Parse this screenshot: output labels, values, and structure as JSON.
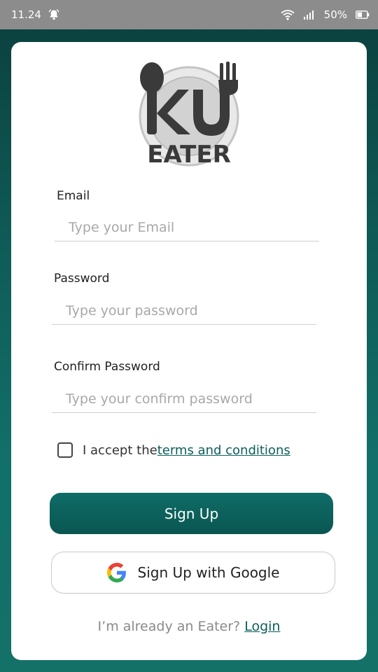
{
  "status_bar": {
    "time": "11.24",
    "battery": "50%",
    "icons": [
      "notification-bell-icon",
      "wifi-icon",
      "signal-icon",
      "battery-icon"
    ]
  },
  "logo": {
    "top_text": "KU",
    "bottom_text": "EATER"
  },
  "form": {
    "email": {
      "label": "Email",
      "placeholder": "Type your Email",
      "value": ""
    },
    "password": {
      "label": "Password",
      "placeholder": "Type your password",
      "value": ""
    },
    "confirm": {
      "label": "Confirm Password",
      "placeholder": "Type your confirm password",
      "value": ""
    },
    "terms": {
      "prefix": "I accept the ",
      "link": "terms and conditions",
      "checked": false
    }
  },
  "buttons": {
    "signup": "Sign Up",
    "google": "Sign Up with Google"
  },
  "footer": {
    "prompt": "I’m already an Eater? ",
    "login": "Login"
  },
  "colors": {
    "accent": "#0b5f5b",
    "status_bar": "#8c8c8c",
    "background_top": "#0a3f3d",
    "background_bottom": "#137168"
  }
}
